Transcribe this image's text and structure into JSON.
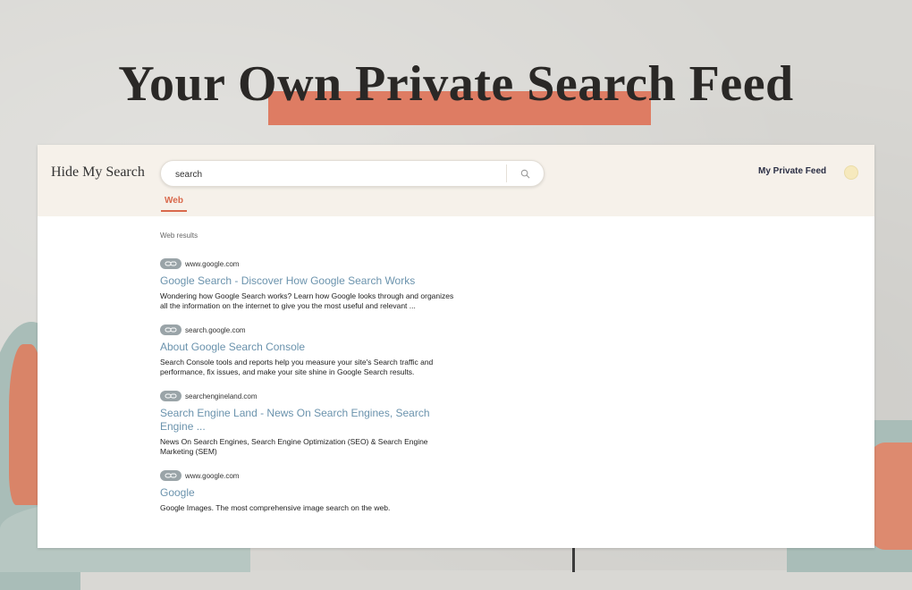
{
  "headline": "Your Own Private Search Feed",
  "colors": {
    "highlight": "#de7c63",
    "accent": "#d9694c",
    "link": "#6b93ad",
    "topbar": "#f6f1ea"
  },
  "app": {
    "brand": "Hide My Search",
    "search": {
      "value": "search",
      "icon": "search-icon"
    },
    "my_feed_label": "My Private Feed",
    "tabs": [
      {
        "label": "Web",
        "active": true
      }
    ],
    "section_label": "Web results"
  },
  "results": [
    {
      "domain": "www.google.com",
      "title": "Google Search - Discover How Google Search Works",
      "snippet": "Wondering how Google Search works? Learn how Google looks through and organizes all the information on the internet to give you the most useful and relevant ..."
    },
    {
      "domain": "search.google.com",
      "title": "About Google Search Console",
      "snippet": "Search Console tools and reports help you measure your site's Search traffic and performance, fix issues, and make your site shine in Google Search results."
    },
    {
      "domain": "searchengineland.com",
      "title": "Search Engine Land - News On Search Engines, Search Engine ...",
      "snippet": "News On Search Engines, Search Engine Optimization (SEO) & Search Engine Marketing (SEM)"
    },
    {
      "domain": "www.google.com",
      "title": "Google",
      "snippet": "Google Images. The most comprehensive image search on the web."
    }
  ]
}
